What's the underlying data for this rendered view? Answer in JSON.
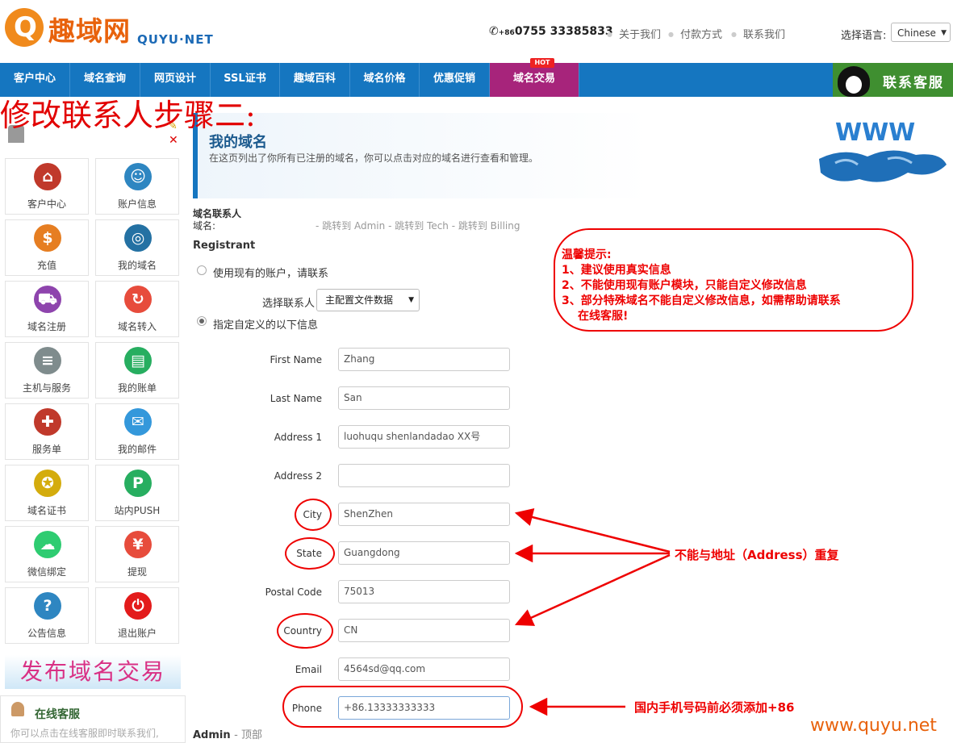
{
  "header": {
    "logo_mark": "Q",
    "logo_cn": "趣域网",
    "logo_en": "QUYU·NET",
    "phone_prefix": "+86",
    "phone": "0755 33385833",
    "links": [
      "关于我们",
      "付款方式",
      "联系我们"
    ],
    "language_label": "选择语言:",
    "language_value": "Chinese"
  },
  "nav": {
    "items": [
      "客户中心",
      "域名查询",
      "网页设计",
      "SSL证书",
      "趣域百科",
      "域名价格",
      "优惠促销",
      "域名交易"
    ],
    "hot_badge": "HOT",
    "service_button": "联系客服"
  },
  "overlay_title": "修改联系人步骤二:",
  "sidebar": {
    "tiles": [
      {
        "label": "客户中心",
        "icon": "home-icon",
        "color": "#c0392b"
      },
      {
        "label": "账户信息",
        "icon": "user-icon",
        "color": "#2e86c1"
      },
      {
        "label": "充值",
        "icon": "coins-icon",
        "color": "#e67e22"
      },
      {
        "label": "我的域名",
        "icon": "globe-icon",
        "color": "#2471a3"
      },
      {
        "label": "域名注册",
        "icon": "cart-icon",
        "color": "#8e44ad"
      },
      {
        "label": "域名转入",
        "icon": "transfer-icon",
        "color": "#e74c3c"
      },
      {
        "label": "主机与服务",
        "icon": "server-icon",
        "color": "#7f8c8d"
      },
      {
        "label": "我的账单",
        "icon": "invoice-icon",
        "color": "#27ae60"
      },
      {
        "label": "服务单",
        "icon": "ticket-icon",
        "color": "#c0392b"
      },
      {
        "label": "我的邮件",
        "icon": "mail-icon",
        "color": "#3498db"
      },
      {
        "label": "域名证书",
        "icon": "certificate-icon",
        "color": "#d4ac0d"
      },
      {
        "label": "站内PUSH",
        "icon": "push-icon",
        "color": "#27ae60"
      },
      {
        "label": "微信绑定",
        "icon": "wechat-icon",
        "color": "#2ecc71"
      },
      {
        "label": "提现",
        "icon": "cash-icon",
        "color": "#e74c3c"
      },
      {
        "label": "公告信息",
        "icon": "help-icon",
        "color": "#2e86c1"
      },
      {
        "label": "退出账户",
        "icon": "power-icon",
        "color": "#e31b1b"
      }
    ],
    "promo_banner": "发布域名交易",
    "online_title": "在线客服",
    "online_text": "你可以点击在线客服即时联系我们,"
  },
  "main": {
    "title": "我的域名",
    "description": "在这页列出了你所有已注册的域名，你可以点击对应的域名进行查看和管理。",
    "www_graphic": "WWW",
    "contact_heading": "域名联系人",
    "domain_label": "域名:",
    "jump_links": "- 跳转到 Admin - 跳转到 Tech - 跳转到 Billing",
    "registrant": "Registrant",
    "option_existing": "使用现有的账户，请联系",
    "choose_contact_label": "选择联系人",
    "profile_select_value": "主配置文件数据",
    "option_custom": "指定自定义的以下信息",
    "fields": [
      {
        "label": "First Name",
        "value": "Zhang"
      },
      {
        "label": "Last Name",
        "value": "San"
      },
      {
        "label": "Address 1",
        "value": "luohuqu shenlandadao XX号"
      },
      {
        "label": "Address 2",
        "value": ""
      },
      {
        "label": "City",
        "value": "ShenZhen"
      },
      {
        "label": "State",
        "value": "Guangdong"
      },
      {
        "label": "Postal Code",
        "value": "75013"
      },
      {
        "label": "Country",
        "value": "CN"
      },
      {
        "label": "Email",
        "value": "4564sd@qq.com"
      },
      {
        "label": "Phone",
        "value": "+86.13333333333"
      }
    ],
    "footer_admin": "Admin",
    "footer_top": "- 顶部"
  },
  "annotations": {
    "tips": [
      "温馨提示:",
      "1、建议使用真实信息",
      "2、不能使用现有账户模块，只能自定义修改信息",
      "3、部分特殊域名不能自定义修改信息，如需帮助请联系",
      "在线客服!"
    ],
    "address_note": "不能与地址（Address）重复",
    "phone_note": "国内手机号码前必须添加+86",
    "watermark": "www.quyu.net",
    "color": "#e00000"
  }
}
